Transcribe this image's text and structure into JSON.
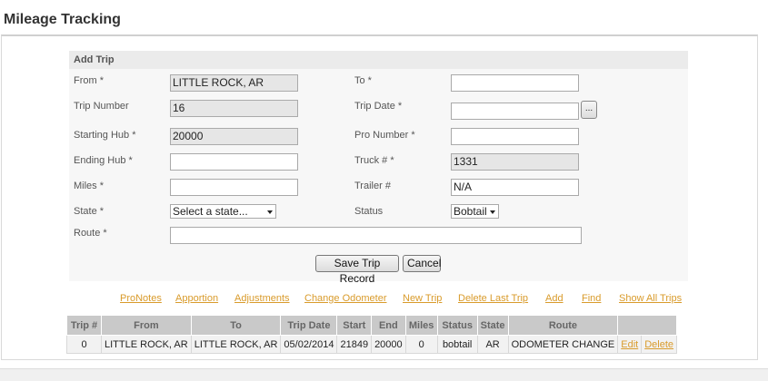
{
  "page": {
    "title": "Mileage Tracking"
  },
  "form": {
    "header": "Add Trip",
    "from_label": "From *",
    "from_value": "LITTLE ROCK, AR",
    "to_label": "To *",
    "to_value": "",
    "trip_number_label": "Trip Number",
    "trip_number_value": "16",
    "trip_date_label": "Trip Date *",
    "trip_date_value": "",
    "calendar_button": "...",
    "starting_hub_label": "Starting Hub *",
    "starting_hub_value": "20000",
    "pro_number_label": "Pro Number *",
    "pro_number_value": "",
    "ending_hub_label": "Ending Hub *",
    "ending_hub_value": "",
    "truck_label": "Truck # *",
    "truck_value": "1331",
    "miles_label": "Miles *",
    "miles_value": "",
    "trailer_label": "Trailer #",
    "trailer_value": "N/A",
    "state_label": "State *",
    "state_selected": "Select a state...",
    "status_label": "Status",
    "status_selected": "Bobtail",
    "route_label": "Route *",
    "route_value": "",
    "save_button": "Save Trip Record",
    "cancel_button": "Cancel"
  },
  "links": [
    "ProNotes",
    "Apportion",
    "Adjustments",
    "Change Odometer",
    "New Trip",
    "Delete Last Trip",
    "Add",
    "Find",
    "Show All Trips"
  ],
  "table": {
    "headers": [
      "Trip #",
      "From",
      "To",
      "Trip Date",
      "Start",
      "End",
      "Miles",
      "Status",
      "State",
      "Route",
      ""
    ],
    "rows": [
      {
        "trip": "0",
        "from": "LITTLE ROCK, AR",
        "to": "LITTLE ROCK, AR",
        "date": "05/02/2014",
        "start": "21849",
        "end": "20000",
        "miles": "0",
        "status": "bobtail",
        "state": "AR",
        "route": "ODOMETER CHANGE",
        "edit": "Edit",
        "delete": "Delete"
      }
    ]
  },
  "colors": {
    "link": "#d99b2b",
    "header_bg": "#c9c9c9",
    "form_bg": "#f7f7f7",
    "readonly_bg": "#e6e6e6"
  }
}
